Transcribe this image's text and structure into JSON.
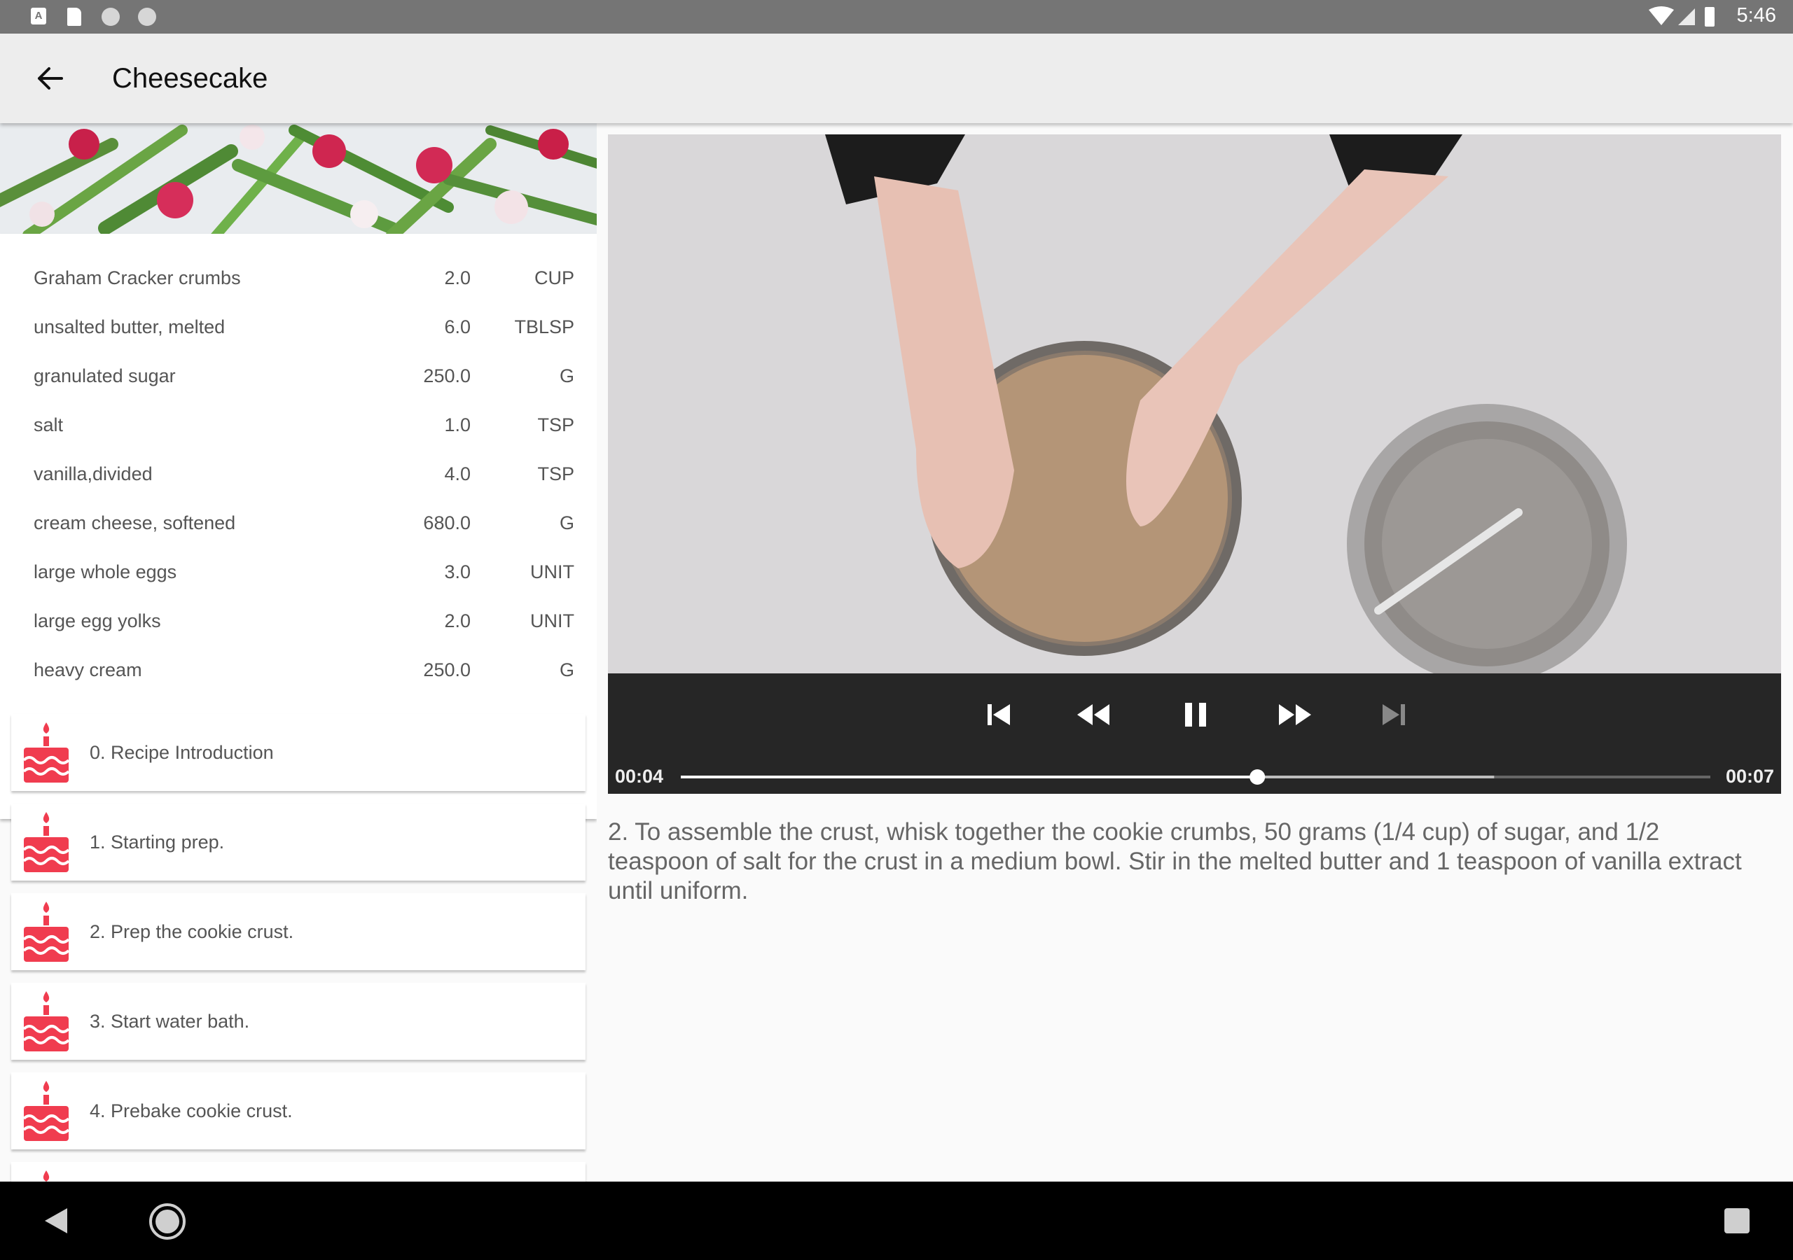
{
  "status_bar": {
    "time": "5:46",
    "app_icon_letter": "A"
  },
  "app_bar": {
    "title": "Cheesecake",
    "back_icon": "arrow-back-icon"
  },
  "ingredients": [
    {
      "name": "Graham Cracker crumbs",
      "quantity": "2.0",
      "unit": "CUP"
    },
    {
      "name": "unsalted butter, melted",
      "quantity": "6.0",
      "unit": "TBLSP"
    },
    {
      "name": "granulated sugar",
      "quantity": "250.0",
      "unit": "G"
    },
    {
      "name": "salt",
      "quantity": "1.0",
      "unit": "TSP"
    },
    {
      "name": "vanilla,divided",
      "quantity": "4.0",
      "unit": "TSP"
    },
    {
      "name": "cream cheese, softened",
      "quantity": "680.0",
      "unit": "G"
    },
    {
      "name": "large whole eggs",
      "quantity": "3.0",
      "unit": "UNIT"
    },
    {
      "name": "large egg yolks",
      "quantity": "2.0",
      "unit": "UNIT"
    },
    {
      "name": "heavy cream",
      "quantity": "250.0",
      "unit": "G"
    }
  ],
  "steps": [
    {
      "label": "0. Recipe Introduction"
    },
    {
      "label": "1. Starting prep."
    },
    {
      "label": "2. Prep the cookie crust."
    },
    {
      "label": "3. Start water bath."
    },
    {
      "label": "4. Prebake cookie crust."
    }
  ],
  "player": {
    "position": "00:04",
    "duration": "00:07",
    "played_fraction": 0.56,
    "buffered_fraction": 0.79
  },
  "step_description": "2. To assemble the crust, whisk together the cookie crumbs, 50 grams (1/4 cup) of sugar, and 1/2 teaspoon of salt for the crust in a medium bowl. Stir in the melted butter and 1 teaspoon of vanilla extract until uniform.",
  "colors": {
    "accent": "#f03c4f",
    "status_bar": "#757575",
    "app_bar": "#ededed",
    "player_controls": "#1e1e1e"
  }
}
